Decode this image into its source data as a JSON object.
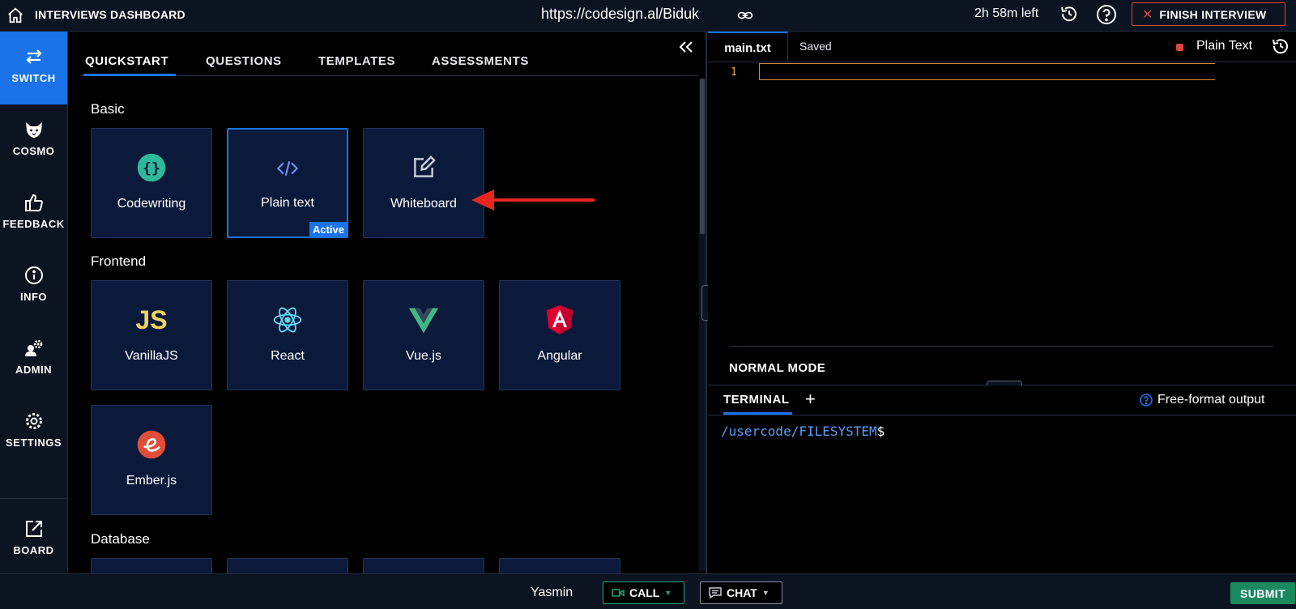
{
  "topbar": {
    "title": "INTERVIEWS DASHBOARD",
    "url": "https://codesign.al/Biduk",
    "time_left": "2h 58m left",
    "finish_label": "FINISH INTERVIEW"
  },
  "leftnav": {
    "items": [
      {
        "label": "SWITCH",
        "icon": "switch-arrows-icon"
      },
      {
        "label": "COSMO",
        "icon": "cosmo-fox-icon"
      },
      {
        "label": "FEEDBACK",
        "icon": "thumbs-up-icon"
      },
      {
        "label": "INFO",
        "icon": "info-icon"
      },
      {
        "label": "ADMIN",
        "icon": "admin-gear-user-icon"
      },
      {
        "label": "SETTINGS",
        "icon": "gear-icon"
      },
      {
        "label": "BOARD",
        "icon": "external-link-icon"
      }
    ]
  },
  "tabs": [
    "QUICKSTART",
    "QUESTIONS",
    "TEMPLATES",
    "ASSESSMENTS"
  ],
  "sections": {
    "basic": "Basic",
    "frontend": "Frontend",
    "database": "Database"
  },
  "tiles": {
    "codewriting": "Codewriting",
    "plaintext": "Plain text",
    "whiteboard": "Whiteboard",
    "vanillajs": "VanillaJS",
    "react": "React",
    "vue": "Vue.js",
    "angular": "Angular",
    "ember": "Ember.js",
    "active_badge": "Active",
    "js_glyph": "JS"
  },
  "editor": {
    "file_tab": "main.txt",
    "status": "Saved",
    "language": "Plain Text",
    "line_number": "1",
    "mode": "NORMAL MODE"
  },
  "terminal": {
    "tab": "TERMINAL",
    "plus": "+",
    "free_format": "Free-format output",
    "prompt_path": "/usercode/FILESYSTEM",
    "prompt_symbol": "$"
  },
  "bottombar": {
    "user": "Yasmin",
    "call": "CALL",
    "chat": "CHAT",
    "submit": "SUBMIT"
  },
  "colors": {
    "accent": "#1a73e8",
    "danger": "#e5443d",
    "success": "#1a8a5e",
    "tile_bg": "#0b1a3a"
  }
}
